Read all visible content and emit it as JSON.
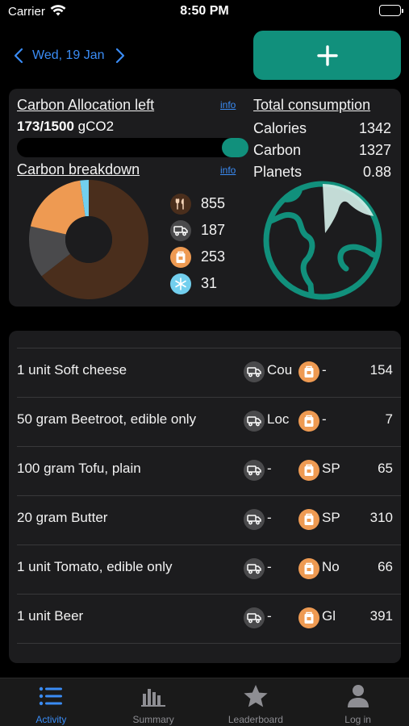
{
  "status_bar": {
    "carrier": "Carrier",
    "time": "8:50 PM"
  },
  "date_nav": {
    "date": "Wed, 19 Jan"
  },
  "allocation": {
    "title": "Carbon Allocation left",
    "info": "info",
    "used": "173/1500",
    "unit": " gCO2",
    "progress_fraction": 0.1153
  },
  "breakdown": {
    "title": "Carbon breakdown",
    "info": "info",
    "items": [
      {
        "icon": "cutlery-icon",
        "value": "855",
        "color": "#4a2e1c"
      },
      {
        "icon": "truck-icon",
        "value": "187",
        "color": "#4a4a4c"
      },
      {
        "icon": "package-icon",
        "value": "253",
        "color": "#ee9a52"
      },
      {
        "icon": "snowflake-icon",
        "value": "31",
        "color": "#72cfee"
      }
    ]
  },
  "totals": {
    "title": "Total consumption",
    "rows": [
      {
        "label": "Calories",
        "value": "1342"
      },
      {
        "label": "Carbon",
        "value": "1327"
      },
      {
        "label": "Planets",
        "value": "0.88"
      }
    ]
  },
  "log": [
    {
      "name": "1 unit Soft cheese",
      "transport": "Cou",
      "packaging": "-",
      "value": "154"
    },
    {
      "name": "50 gram Beetroot, edible only",
      "transport": "Loc",
      "packaging": "-",
      "value": "7"
    },
    {
      "name": "100 gram Tofu, plain",
      "transport": "-",
      "packaging": "SP",
      "value": "65"
    },
    {
      "name": "20 gram Butter",
      "transport": "-",
      "packaging": "SP",
      "value": "310"
    },
    {
      "name": "1 unit Tomato, edible only",
      "transport": "-",
      "packaging": "No",
      "value": "66"
    },
    {
      "name": "1 unit Beer",
      "transport": "-",
      "packaging": "Gl",
      "value": "391"
    }
  ],
  "tabs": [
    {
      "label": "Activity",
      "icon": "list-icon",
      "active": true
    },
    {
      "label": "Summary",
      "icon": "bar-chart-icon",
      "active": false
    },
    {
      "label": "Leaderboard",
      "icon": "star-icon",
      "active": false
    },
    {
      "label": "Log in",
      "icon": "person-icon",
      "active": false
    }
  ],
  "colors": {
    "accent": "#11907c",
    "link": "#3a8cf5",
    "food": "#4a2e1c",
    "transport": "#4a4a4c",
    "packaging": "#ee9a52",
    "storage": "#72cfee"
  }
}
